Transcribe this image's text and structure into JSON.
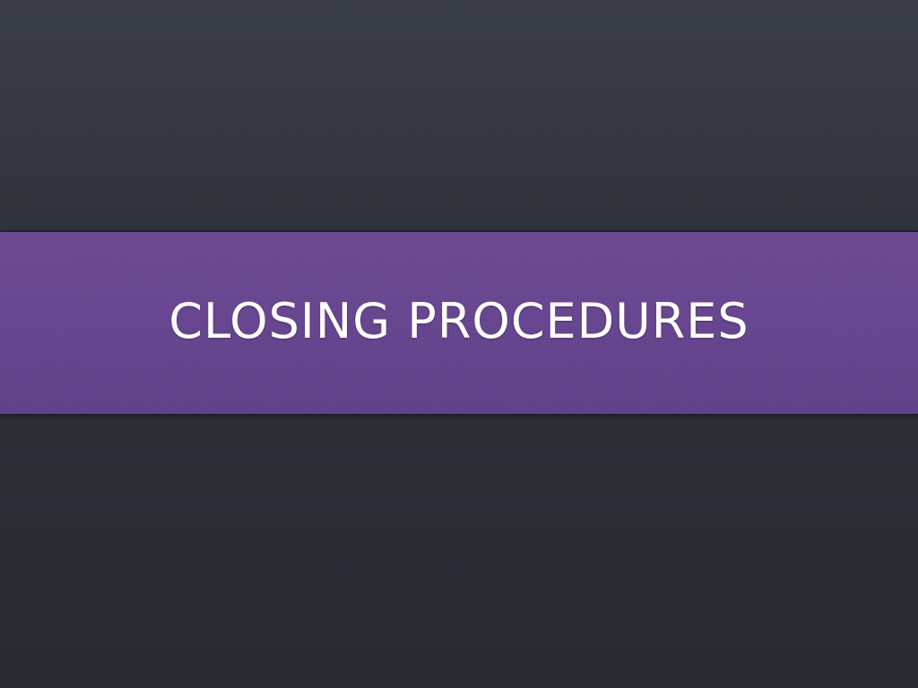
{
  "slide": {
    "title": "CLOSING PROCEDURES"
  },
  "colors": {
    "background_top": "#393d46",
    "background_bottom": "#272a31",
    "band": "#674590",
    "title_text": "#ffffff"
  }
}
